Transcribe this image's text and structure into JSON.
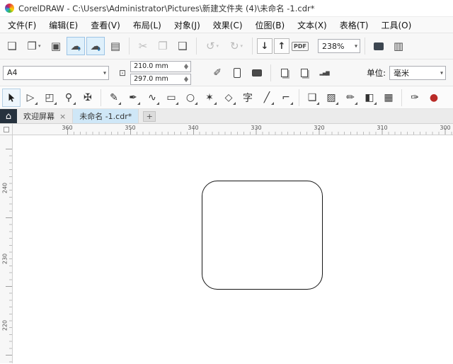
{
  "window": {
    "title": "CorelDRAW - C:\\Users\\Administrator\\Pictures\\新建文件夹 (4)\\未命名 -1.cdr*"
  },
  "colors": {
    "active_button_bg": "#dff0fb",
    "active_button_border": "#9cc3e5",
    "active_tab_bg": "#cfe7f7",
    "home_button_bg": "#26323e",
    "shape_stroke": "#161616"
  },
  "menu": {
    "items": [
      {
        "label": "文件(F)"
      },
      {
        "label": "编辑(E)"
      },
      {
        "label": "查看(V)"
      },
      {
        "label": "布局(L)"
      },
      {
        "label": "对象(J)"
      },
      {
        "label": "效果(C)"
      },
      {
        "label": "位图(B)"
      },
      {
        "label": "文本(X)"
      },
      {
        "label": "表格(T)"
      },
      {
        "label": "工具(O)"
      }
    ]
  },
  "toolbar": {
    "icons": [
      {
        "name": "new-document",
        "glyph": "❏"
      },
      {
        "name": "open",
        "glyph": "❒"
      },
      {
        "name": "save",
        "glyph": "▣"
      },
      {
        "name": "cloud-upload",
        "glyph": "☁",
        "overlay": "↑"
      },
      {
        "name": "cloud-download",
        "glyph": "☁",
        "overlay": "↓"
      },
      {
        "name": "print",
        "glyph": "▤"
      },
      {
        "name": "cut",
        "glyph": "✂"
      },
      {
        "name": "copy",
        "glyph": "❐"
      },
      {
        "name": "paste",
        "glyph": "❑"
      },
      {
        "name": "undo",
        "glyph": "↺"
      },
      {
        "name": "redo",
        "glyph": "↻"
      },
      {
        "name": "import",
        "glyph": "↓"
      },
      {
        "name": "export",
        "glyph": "↑"
      },
      {
        "name": "pdf",
        "glyph": "PDF"
      },
      {
        "name": "show-rulers",
        "glyph": "▥"
      }
    ],
    "zoom_value": "238%"
  },
  "property_bar": {
    "page_preset": "A4",
    "width_value": "210.0 mm",
    "height_value": "297.0 mm",
    "dims_glyph": "⊡",
    "scale_glyph": "✐",
    "page_sort_glyph": "▂▄▆",
    "units_label": "单位:",
    "units_value": "毫米"
  },
  "toolbox": {
    "tools": [
      {
        "name": "pick-tool",
        "glyph": ""
      },
      {
        "name": "shape-tool",
        "glyph": "▷"
      },
      {
        "name": "crop-tool",
        "glyph": "◰"
      },
      {
        "name": "zoom-tool",
        "glyph": "⚲"
      },
      {
        "name": "pan-tool",
        "glyph": "✠"
      },
      {
        "name": "freehand-tool",
        "glyph": "✎"
      },
      {
        "name": "pen-tool",
        "glyph": "✒"
      },
      {
        "name": "bezier-tool",
        "glyph": "∿"
      },
      {
        "name": "rectangle-tool",
        "glyph": "▭"
      },
      {
        "name": "ellipse-tool",
        "glyph": "○"
      },
      {
        "name": "polygon-tool",
        "glyph": "✶"
      },
      {
        "name": "common-shapes-tool",
        "glyph": "◇"
      },
      {
        "name": "text-tool",
        "glyph": "字"
      },
      {
        "name": "dimension-tool",
        "glyph": "╱"
      },
      {
        "name": "connector-tool",
        "glyph": "⌐"
      },
      {
        "name": "drop-shadow-tool",
        "glyph": "❑"
      },
      {
        "name": "transparency-tool",
        "glyph": "▨"
      },
      {
        "name": "color-eyedropper-tool",
        "glyph": "✏"
      },
      {
        "name": "interactive-fill-tool",
        "glyph": "◧"
      },
      {
        "name": "smart-fill-tool",
        "glyph": "▦"
      },
      {
        "name": "outline-pen-tool",
        "glyph": "✑"
      },
      {
        "name": "fill-color-tool",
        "glyph": "●"
      }
    ]
  },
  "tabs": {
    "home_glyph": "⌂",
    "items": [
      {
        "label": "欢迎屏幕",
        "close": "×"
      },
      {
        "label": "未命名 -1.cdr*"
      }
    ],
    "add_label": "+"
  },
  "rulers": {
    "horizontal": [
      "360",
      "350",
      "340",
      "330",
      "320",
      "310",
      "300"
    ],
    "vertical": [
      "240",
      "230",
      "220"
    ]
  },
  "canvas": {
    "object": "rounded-rectangle"
  }
}
